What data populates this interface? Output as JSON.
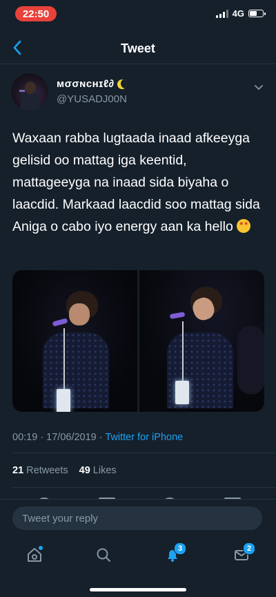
{
  "status_bar": {
    "time": "22:50",
    "network": "4G",
    "battery_level": 0.55
  },
  "header": {
    "title": "Tweet",
    "back_icon": "chevron-left-icon"
  },
  "tweet": {
    "author": {
      "display_name": "ᴍσσɴᴄнɪℓ∂",
      "handle": "@YUSADJ00N"
    },
    "text": "Waxaan rabba lugtaada inaad afkeeyga gelisid oo mattag iga keentid, mattageeyga na inaad sida biyaha o laacdid. Markaad laacdid soo mattag sida Aniga o cabo iyo energy aan ka hello",
    "timestamp": "00:19 · 17/06/2019 · ",
    "source": "Twitter for iPhone",
    "retweets_count": "21",
    "retweets_label": "Retweets",
    "likes_count": "49",
    "likes_label": "Likes"
  },
  "reply": {
    "placeholder": "Tweet your reply"
  },
  "tab_bar": {
    "items": [
      {
        "name": "home",
        "icon": "home-icon"
      },
      {
        "name": "search",
        "icon": "search-icon"
      },
      {
        "name": "notifications",
        "icon": "bell-icon",
        "badge": "3"
      },
      {
        "name": "messages",
        "icon": "mail-icon",
        "badge": "2"
      }
    ]
  },
  "colors": {
    "background": "#15202b",
    "accent": "#1da1f2",
    "secondary_text": "#8899a6",
    "time_pill": "#e8423b"
  }
}
